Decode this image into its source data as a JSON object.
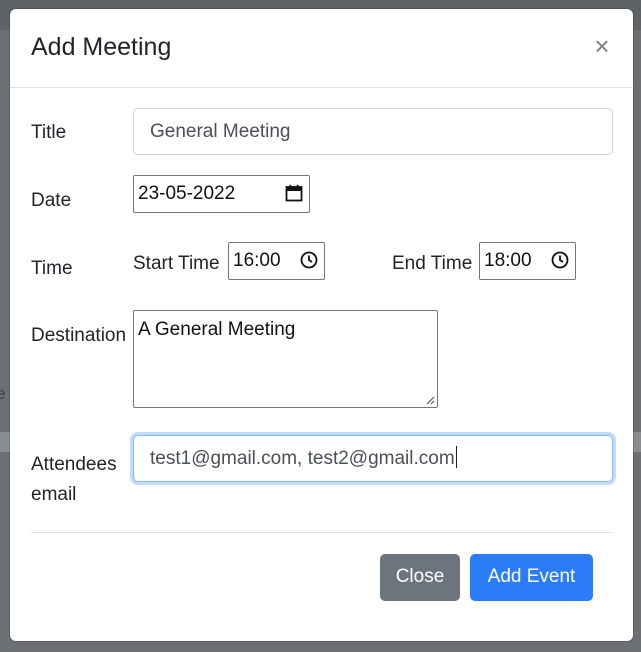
{
  "backdrop": {
    "partial_text": "e"
  },
  "modal": {
    "title": "Add Meeting",
    "close_symbol": "×"
  },
  "form": {
    "title": {
      "label": "Title",
      "value": "General Meeting"
    },
    "date": {
      "label": "Date",
      "value": "23-05-2022",
      "icon": "calendar-icon"
    },
    "time": {
      "label": "Time",
      "start_label": "Start Time",
      "start_value": "16:00",
      "end_label": "End Time",
      "end_value": "18:00",
      "icon": "clock-icon"
    },
    "destination": {
      "label": "Destination",
      "value": "A General Meeting"
    },
    "attendees": {
      "label_line1": "Attendees",
      "label_line2": "email",
      "value": "test1@gmail.com, test2@gmail.com"
    }
  },
  "footer": {
    "close_label": "Close",
    "add_label": "Add Event"
  },
  "colors": {
    "primary": "#2a7df7",
    "secondary": "#6c757d",
    "focus_border": "#86b7fe"
  }
}
